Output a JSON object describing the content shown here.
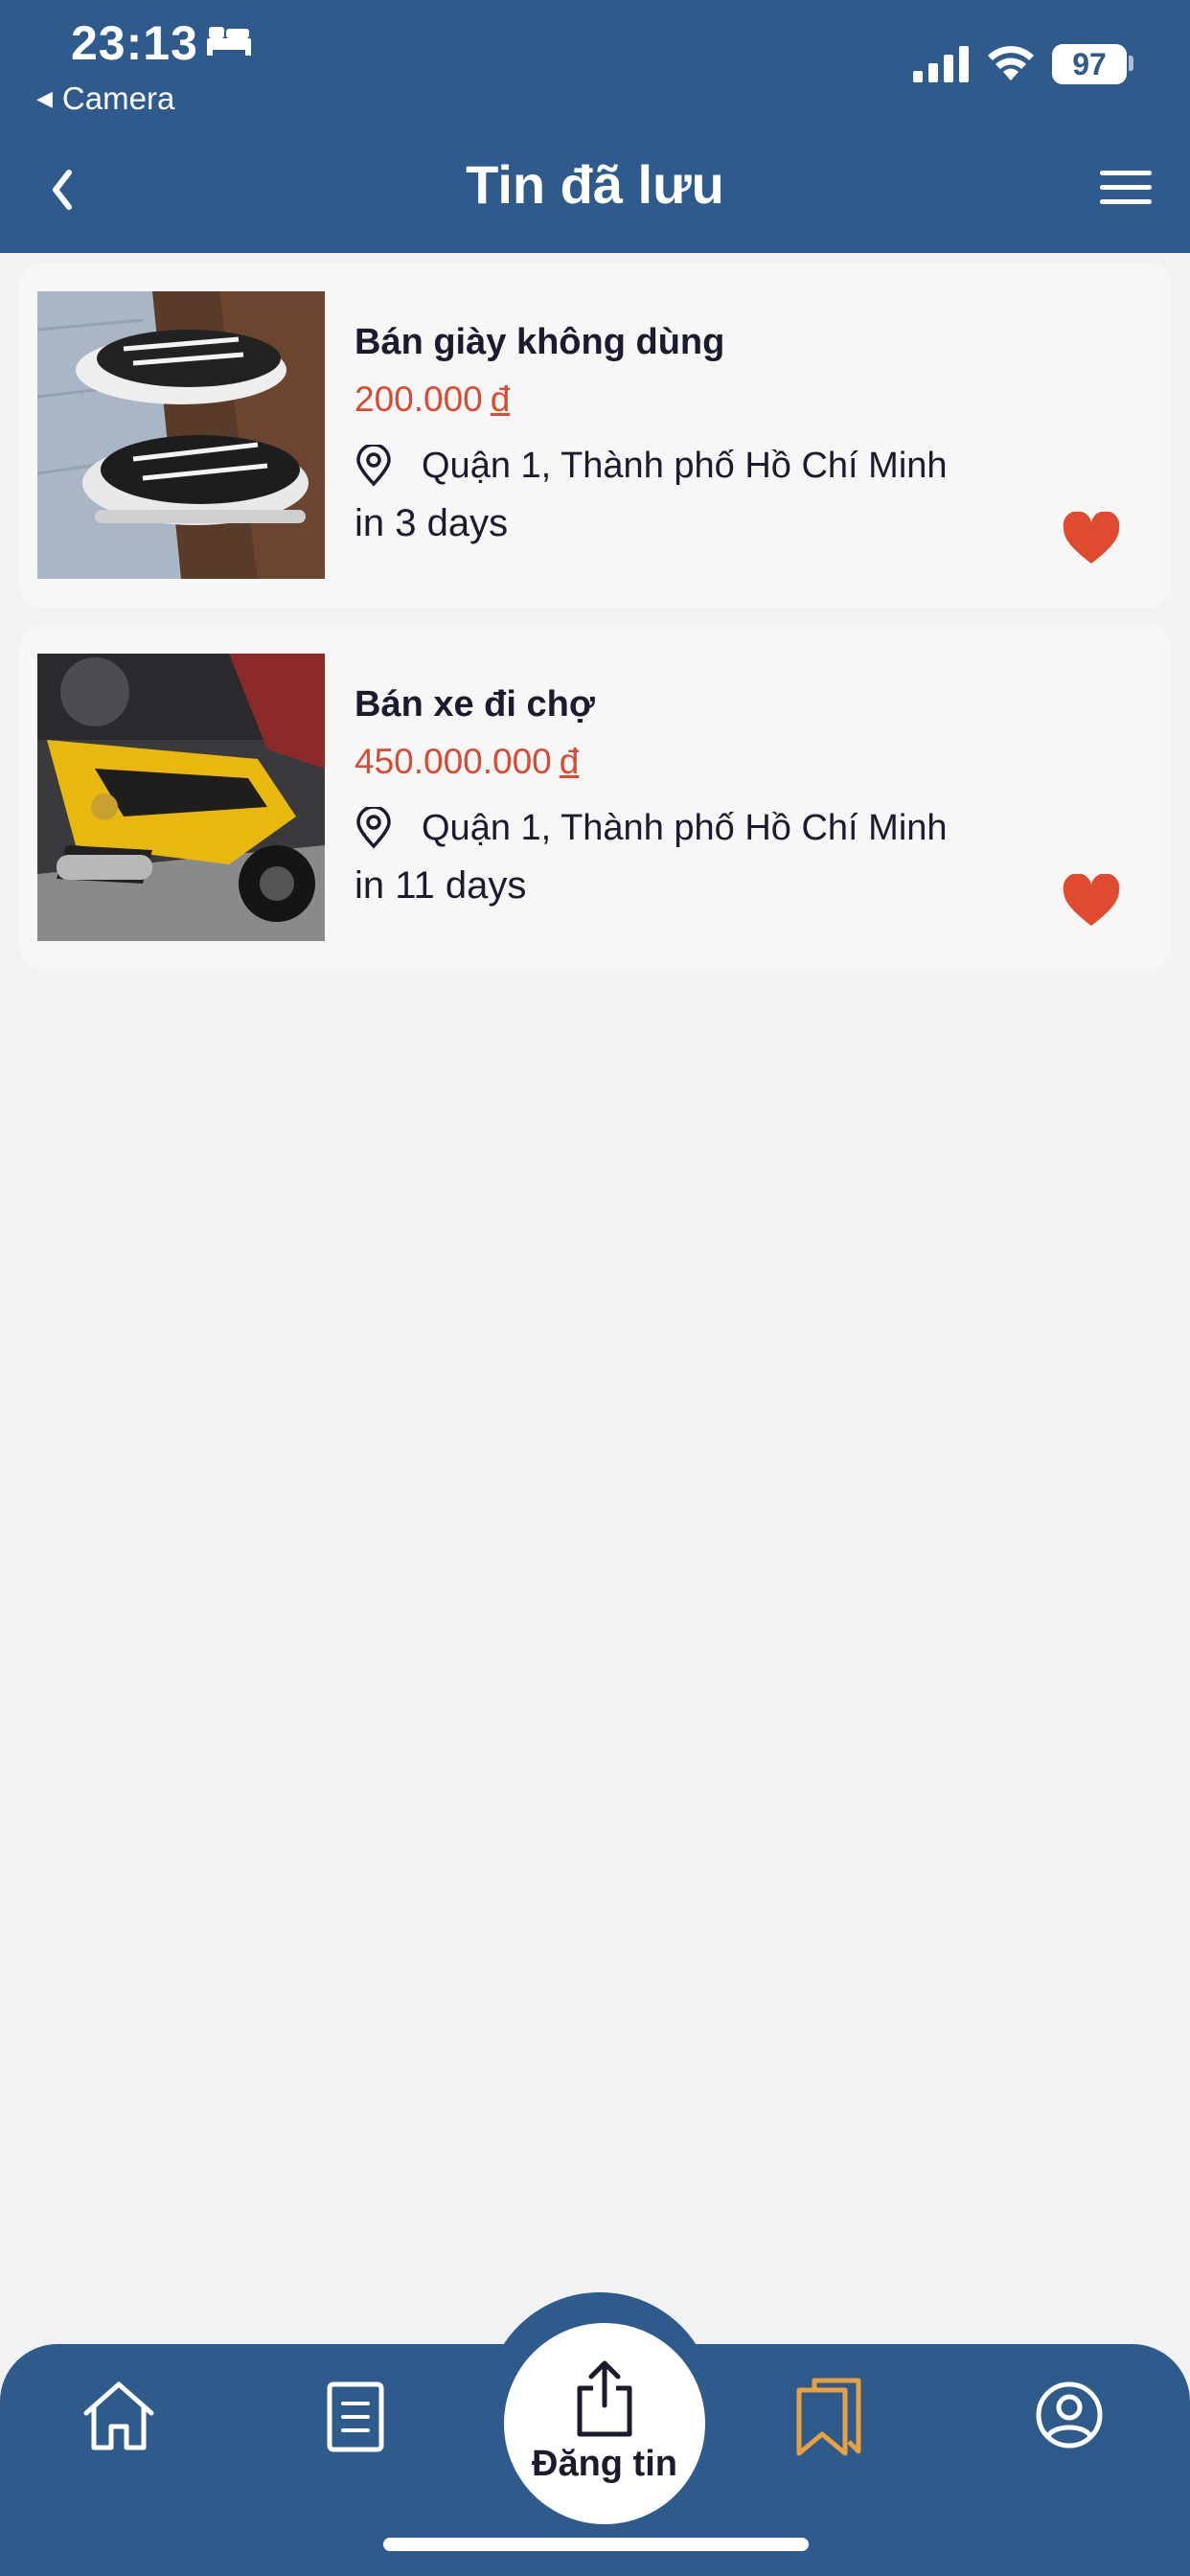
{
  "status_bar": {
    "time": "23:13",
    "back_app": "Camera",
    "battery": "97",
    "icons": [
      "bed-icon",
      "signal-icon",
      "wifi-icon",
      "battery-icon"
    ]
  },
  "nav": {
    "title": "Tin đã lưu",
    "back_icon": "chevron-left-icon",
    "menu_icon": "hamburger-menu-icon"
  },
  "listings": [
    {
      "title": "Bán giày không dùng",
      "price": "200.000",
      "currency": "đ",
      "location": "Quận 1, Thành phố Hồ Chí Minh",
      "time": "in 3 days",
      "saved": true,
      "image": "sneakers-photo"
    },
    {
      "title": "Bán xe đi chợ",
      "price": "450.000.000",
      "currency": "đ",
      "location": "Quận 1, Thành phố Hồ Chí Minh",
      "time": "in 11 days",
      "saved": true,
      "image": "motorbike-photo"
    }
  ],
  "tabbar": {
    "post_label": "Đăng tin",
    "tabs": [
      "home-icon",
      "posts-icon",
      "upload-icon",
      "bookmarks-icon",
      "account-icon"
    ],
    "active_tab": "bookmarks-icon"
  },
  "colors": {
    "primary": "#2f5a8c",
    "price": "#d84a32",
    "heart": "#e04a2f",
    "active_tab": "#e8a040",
    "background": "#f2f2f2",
    "card": "#f7f7f7"
  }
}
